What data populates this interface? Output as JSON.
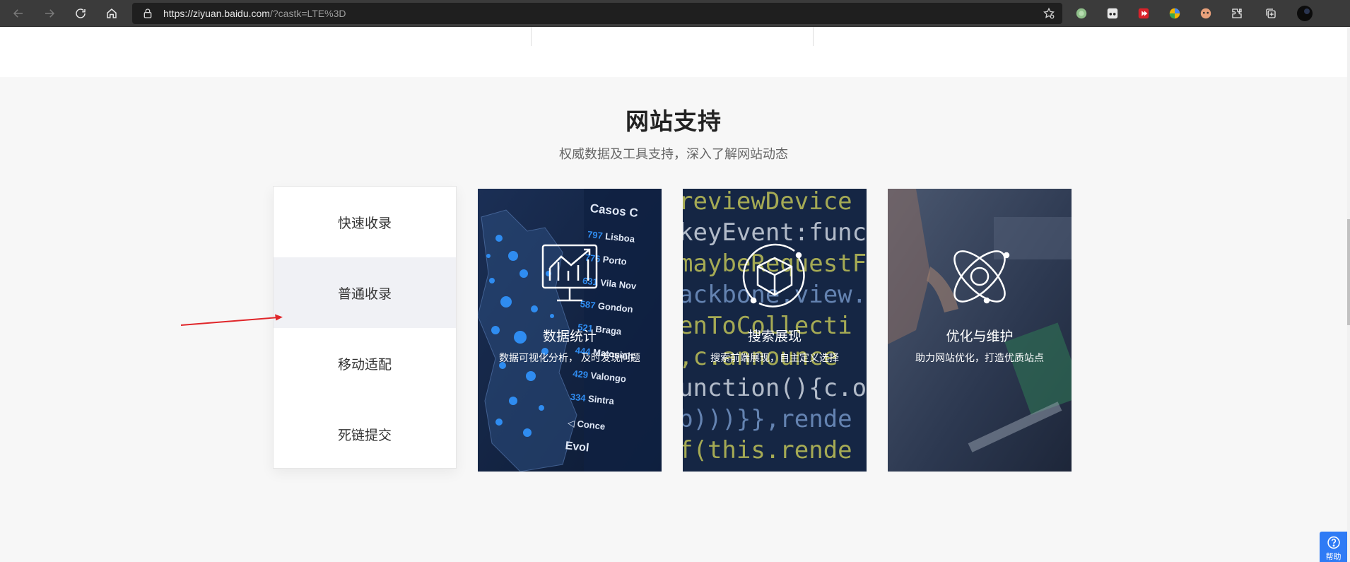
{
  "browser": {
    "url_host": "https://ziyuan.baidu.com",
    "url_path": "/?castk=LTE%3D"
  },
  "section": {
    "title": "网站支持",
    "subtitle": "权威数据及工具支持，深入了解网站动态"
  },
  "menu": {
    "items": [
      {
        "label": "快速收录"
      },
      {
        "label": "普通收录"
      },
      {
        "label": "移动适配"
      },
      {
        "label": "死链提交"
      }
    ]
  },
  "cards": [
    {
      "title": "数据统计",
      "desc": "数据可视化分析， 及时发现问题"
    },
    {
      "title": "搜索展现",
      "desc": "搜索前端展现，自主定义选择"
    },
    {
      "title": "优化与维护",
      "desc": "助力网站优化，打造优质站点"
    }
  ],
  "card1_bg_labels": {
    "header": "Casos C",
    "rows": [
      {
        "num": "797",
        "name": "Lisboa"
      },
      {
        "num": "776",
        "name": "Porto"
      },
      {
        "num": "631",
        "name": "Vila Nov"
      },
      {
        "num": "587",
        "name": "Gondon"
      },
      {
        "num": "521",
        "name": "Braga"
      },
      {
        "num": "444",
        "name": "Matosinh"
      },
      {
        "num": "429",
        "name": "Valongo"
      },
      {
        "num": "334",
        "name": "Sintra"
      }
    ],
    "footer": "Conce",
    "footer2": "Evol"
  },
  "card2_code_lines": [
    "reviewDevice",
    "keyEvent:functi",
    "maybeRequestFi",
    "ackbone.view.ex",
    "enToCollecti",
    ",c.announce",
    "unction(){c.over",
    "b)))}},rende",
    "f(this.rende"
  ],
  "help": {
    "label": "帮助"
  },
  "colors": {
    "accent": "#2f7bf5",
    "arrow": "#e0262a",
    "menu_active_bg": "#f0f1f5"
  }
}
